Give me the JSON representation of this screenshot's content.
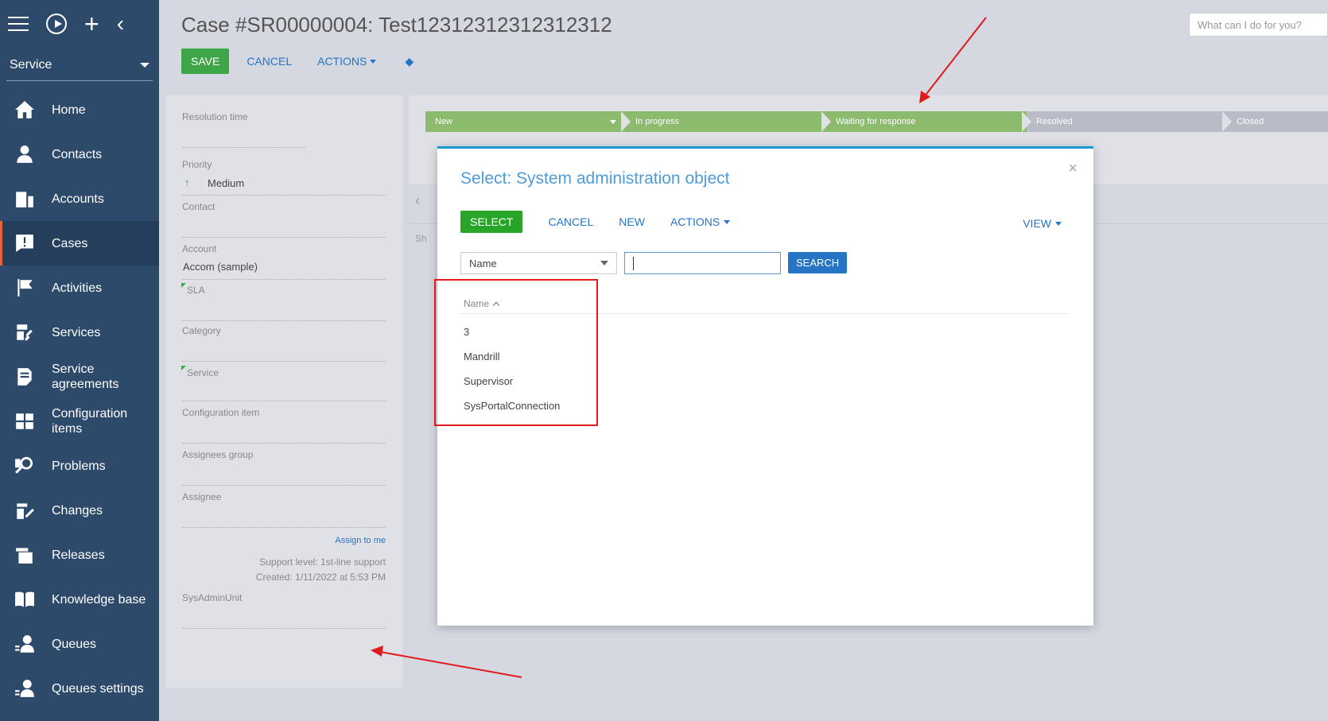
{
  "sidebar": {
    "workspace": "Service",
    "items": [
      {
        "label": "Home",
        "icon": "home-icon"
      },
      {
        "label": "Contacts",
        "icon": "person-icon"
      },
      {
        "label": "Accounts",
        "icon": "building-icon"
      },
      {
        "label": "Cases",
        "icon": "alert-icon",
        "active": true
      },
      {
        "label": "Activities",
        "icon": "flag-icon"
      },
      {
        "label": "Services",
        "icon": "wrench-icon"
      },
      {
        "label": "Service agreements",
        "icon": "document-icon"
      },
      {
        "label": "Configuration items",
        "icon": "grid-icon"
      },
      {
        "label": "Problems",
        "icon": "magnifier-icon"
      },
      {
        "label": "Changes",
        "icon": "pencil-icon"
      },
      {
        "label": "Releases",
        "icon": "stack-icon"
      },
      {
        "label": "Knowledge base",
        "icon": "book-icon"
      },
      {
        "label": "Queues",
        "icon": "queue-icon"
      },
      {
        "label": "Queues settings",
        "icon": "queue-settings-icon"
      }
    ]
  },
  "header": {
    "title": "Case #SR00000004: Test12312312312312312",
    "save": "SAVE",
    "cancel": "CANCEL",
    "actions": "ACTIONS",
    "search_placeholder": "What can I do for you?"
  },
  "stages": [
    "New",
    "In progress",
    "Waiting for response",
    "Resolved",
    "Closed"
  ],
  "details": {
    "resolution_time": "Resolution time",
    "priority_label": "Priority",
    "priority_value": "Medium",
    "contact_label": "Contact",
    "account_label": "Account",
    "account_value": "Accom (sample)",
    "sla_label": "SLA",
    "category_label": "Category",
    "service_label": "Service",
    "config_label": "Configuration item",
    "assignees_group_label": "Assignees group",
    "assignee_label": "Assignee",
    "assign_to_me": "Assign to me",
    "support_level": "Support level: 1st-line support",
    "created": "Created: 1/11/2022 at 5:53 PM",
    "sysadminunit_label": "SysAdminUnit"
  },
  "main": {
    "tab_prefix": "Sh"
  },
  "modal": {
    "title": "Select: System administration object",
    "select": "SELECT",
    "cancel": "CANCEL",
    "new": "NEW",
    "actions": "ACTIONS",
    "view": "VIEW",
    "filter_column": "Name",
    "search_value": "",
    "search_button": "SEARCH",
    "column_header": "Name",
    "rows": [
      "3",
      "Mandrill",
      "Supervisor",
      "SysPortalConnection"
    ]
  },
  "colors": {
    "sidebar_bg": "#2d4a6b",
    "save_green": "#3ea549",
    "link_blue": "#2674c4",
    "annotation_red": "#e01b1b"
  }
}
